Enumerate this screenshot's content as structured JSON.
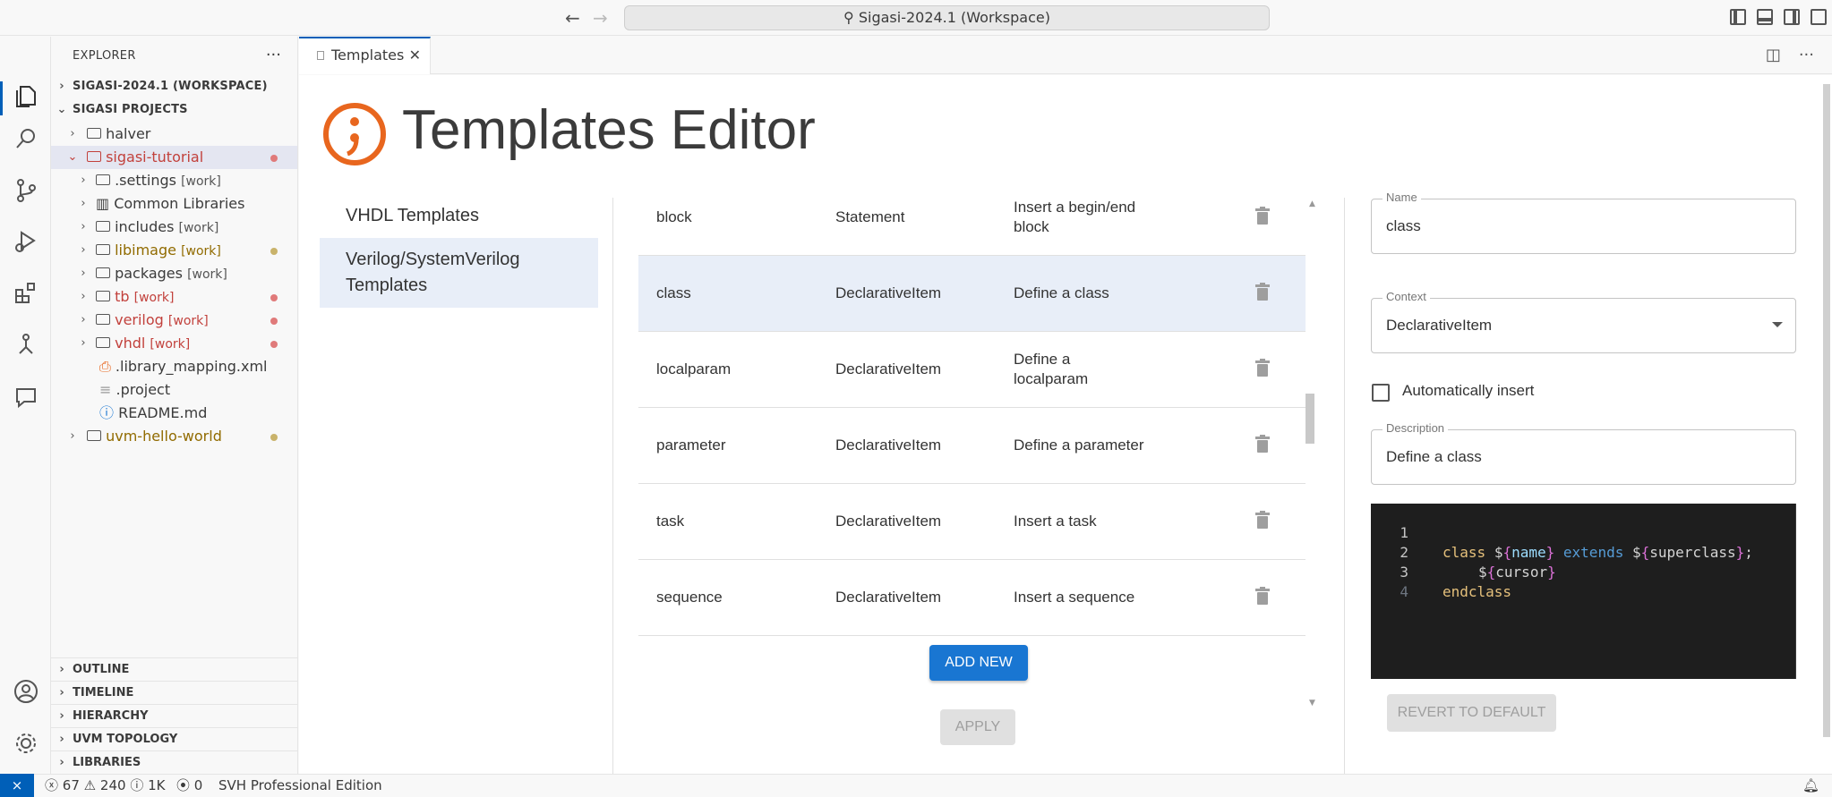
{
  "titlebar": {
    "search_text": "Sigasi-2024.1 (Workspace)"
  },
  "explorer": {
    "header": "EXPLORER",
    "workspace": "SIGASI-2024.1 (WORKSPACE)",
    "projects": "SIGASI PROJECTS",
    "items": [
      {
        "label": "halver",
        "tag": ""
      },
      {
        "label": "sigasi-tutorial",
        "tag": ""
      },
      {
        "label": ".settings",
        "tag": "[work]"
      },
      {
        "label": "Common Libraries",
        "tag": ""
      },
      {
        "label": "includes",
        "tag": "[work]"
      },
      {
        "label": "libimage",
        "tag": "[work]"
      },
      {
        "label": "packages",
        "tag": "[work]"
      },
      {
        "label": "tb",
        "tag": "[work]"
      },
      {
        "label": "verilog",
        "tag": "[work]"
      },
      {
        "label": "vhdl",
        "tag": "[work]"
      },
      {
        "label": ".library_mapping.xml",
        "tag": ""
      },
      {
        "label": ".project",
        "tag": ""
      },
      {
        "label": "README.md",
        "tag": ""
      },
      {
        "label": "uvm-hello-world",
        "tag": ""
      }
    ],
    "sections": [
      "OUTLINE",
      "TIMELINE",
      "HIERARCHY",
      "UVM TOPOLOGY",
      "LIBRARIES"
    ]
  },
  "tab": {
    "label": "Templates"
  },
  "editor": {
    "title": "Templates Editor",
    "languages": [
      "VHDL Templates",
      "Verilog/SystemVerilog Templates"
    ],
    "rows": [
      {
        "name": "block",
        "context": "Statement",
        "description": "Insert a begin/end block"
      },
      {
        "name": "class",
        "context": "DeclarativeItem",
        "description": "Define a class"
      },
      {
        "name": "localparam",
        "context": "DeclarativeItem",
        "description": "Define a localparam"
      },
      {
        "name": "parameter",
        "context": "DeclarativeItem",
        "description": "Define a parameter"
      },
      {
        "name": "task",
        "context": "DeclarativeItem",
        "description": "Insert a task"
      },
      {
        "name": "sequence",
        "context": "DeclarativeItem",
        "description": "Insert a sequence"
      }
    ],
    "add_new": "ADD NEW",
    "apply": "APPLY",
    "form": {
      "name_label": "Name",
      "name_value": "class",
      "context_label": "Context",
      "context_value": "DeclarativeItem",
      "auto_insert_label": "Automatically insert",
      "description_label": "Description",
      "description_value": "Define a class",
      "revert": "REVERT TO DEFAULT"
    },
    "code": {
      "line_numbers": [
        "1",
        "2",
        "3",
        "4"
      ],
      "l1_kw": "class",
      "l1_dollar1": "$",
      "l1_open1": "{",
      "l1_name": "name",
      "l1_close1": "}",
      "l1_ext": "extends",
      "l1_dollar2": "$",
      "l1_open2": "{",
      "l1_super": "superclass",
      "l1_close2": "}",
      "l1_semi": ";",
      "l2_dollar": "$",
      "l2_open": "{",
      "l2_cursor": "cursor",
      "l2_close": "}",
      "l3_kw": "endclass"
    }
  },
  "statusbar": {
    "errors": "67",
    "warnings": "240",
    "infos": "1K",
    "ports": "0",
    "edition": "SVH Professional Edition"
  },
  "colors": {
    "accent": "#005fb8",
    "logo": "#e8661e",
    "add_button": "#1976d2",
    "error_red": "#c2413c"
  }
}
